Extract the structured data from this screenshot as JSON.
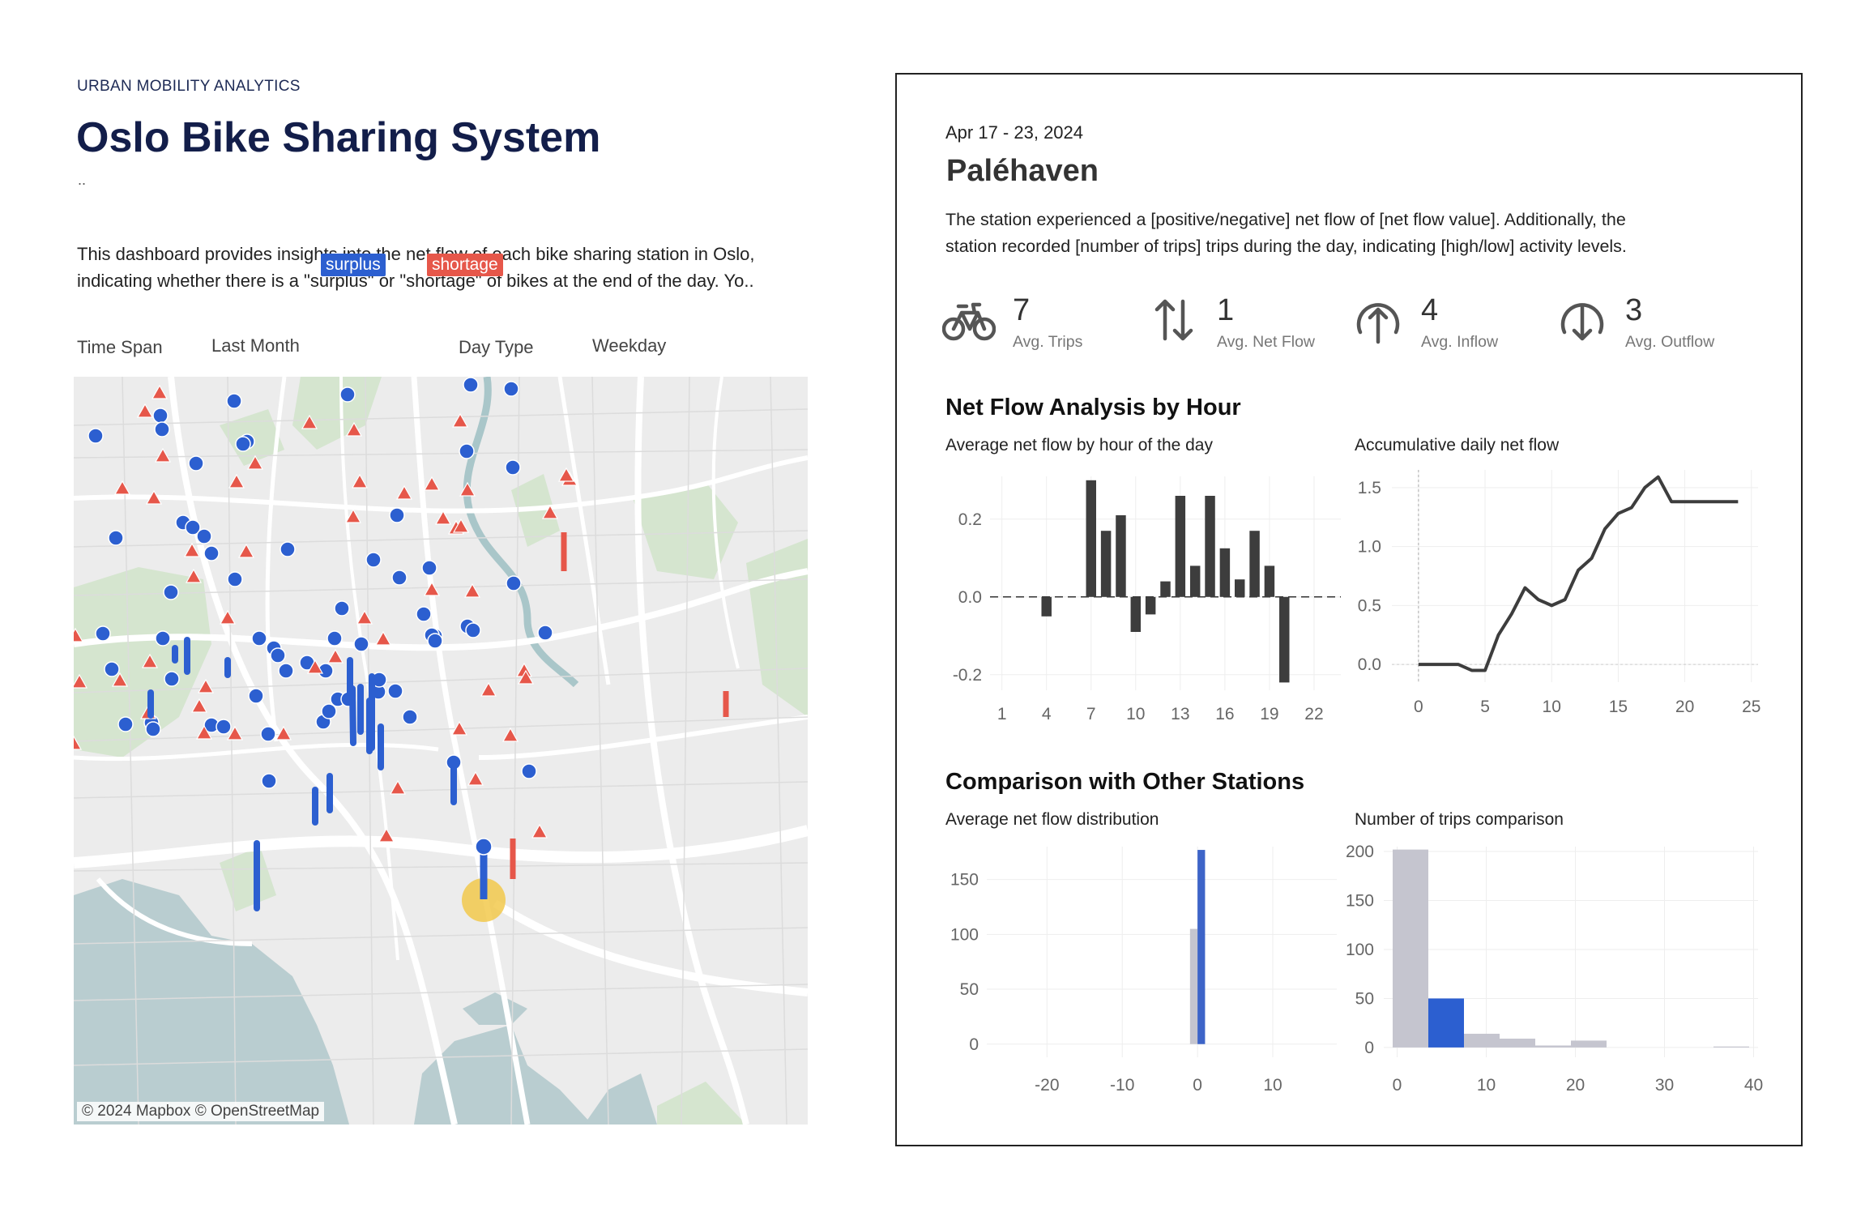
{
  "header": {
    "kicker": "URBAN MOBILITY ANALYTICS",
    "title": "Oslo Bike Sharing System",
    "subtitle": "..",
    "description_line1": "This dashboard provides insights into the net flow of each bike sharing station in Oslo,",
    "description_line2": "indicating whether there is a \"surplus\" or \"shortage\" of bikes at the end of the day. Yo..",
    "surplus_label": "surplus",
    "shortage_label": "shortage"
  },
  "filters": {
    "time_span_label": "Time Span",
    "time_span_value": "Last Month",
    "day_type_label": "Day Type",
    "day_type_value": "Weekday"
  },
  "map": {
    "attribution": "© 2024 Mapbox © OpenStreetMap",
    "surplus_color": "#2c5fd0",
    "shortage_color": "#e6574a",
    "selected_color": "#f2c94c"
  },
  "panel": {
    "date_range": "Apr 17 - 23, 2024",
    "station_name": "Paléhaven",
    "summary_line1": "The station experienced a [positive/negative] net flow of [net flow value]. Additionally, the",
    "summary_line2": "station recorded [number of trips] trips during the day, indicating [high/low] activity levels.",
    "kpis": [
      {
        "icon": "bicycle-icon",
        "value": "7",
        "label": "Avg. Trips"
      },
      {
        "icon": "up-down-arrows-icon",
        "value": "1",
        "label": "Avg. Net Flow"
      },
      {
        "icon": "inflow-arrow-icon",
        "value": "4",
        "label": "Avg. Inflow"
      },
      {
        "icon": "outflow-arrow-icon",
        "value": "3",
        "label": "Avg. Outflow"
      }
    ],
    "section1_title": "Net Flow Analysis by Hour",
    "chart1_title": "Average net flow by hour of the day",
    "chart2_title": "Accumulative daily net flow",
    "section2_title": "Comparison with Other Stations",
    "chart3_title": "Average net flow distribution",
    "chart4_title": "Number of trips comparison"
  },
  "chart_data": [
    {
      "type": "bar",
      "title": "Average net flow by hour of the day",
      "x": [
        1,
        2,
        3,
        4,
        5,
        6,
        7,
        8,
        9,
        10,
        11,
        12,
        13,
        14,
        15,
        16,
        17,
        18,
        19,
        20,
        21,
        22,
        23
      ],
      "values": [
        0,
        0,
        0,
        -0.05,
        0,
        0,
        0.3,
        0.17,
        0.21,
        -0.09,
        -0.045,
        0.04,
        0.26,
        0.08,
        0.26,
        0.125,
        0.045,
        0.17,
        0.08,
        -0.22,
        0,
        0,
        0
      ],
      "xticks": [
        1,
        4,
        7,
        10,
        13,
        16,
        19,
        22
      ],
      "yticks": [
        -0.2,
        0.0,
        0.2
      ],
      "ylim": [
        -0.24,
        0.31
      ],
      "color": "#3d3d3d"
    },
    {
      "type": "line",
      "title": "Accumulative daily net flow",
      "x": [
        0,
        1,
        2,
        3,
        4,
        5,
        6,
        7,
        8,
        9,
        10,
        11,
        12,
        13,
        14,
        15,
        16,
        17,
        18,
        19,
        20,
        21,
        22,
        23,
        24
      ],
      "values": [
        0,
        0,
        0,
        0,
        -0.05,
        -0.05,
        0.25,
        0.43,
        0.65,
        0.55,
        0.5,
        0.55,
        0.8,
        0.9,
        1.15,
        1.28,
        1.33,
        1.5,
        1.59,
        1.38,
        1.38,
        1.38,
        1.38,
        1.38,
        1.38
      ],
      "xticks": [
        0,
        5,
        10,
        15,
        20,
        25
      ],
      "yticks": [
        0.0,
        0.5,
        1.0,
        1.5
      ],
      "xlim": [
        -2,
        25.5
      ],
      "ylim": [
        -0.15,
        1.65
      ],
      "color": "#3d3d3d"
    },
    {
      "type": "bar",
      "title": "Average net flow distribution",
      "bins": [
        {
          "x0": -1,
          "x1": 0,
          "value": 105,
          "highlight": false
        },
        {
          "x0": 0,
          "x1": 1,
          "value": 177,
          "highlight": true
        }
      ],
      "xticks": [
        -20,
        -10,
        0,
        10
      ],
      "yticks": [
        0,
        50,
        100,
        150
      ],
      "xlim": [
        -28,
        18.5
      ],
      "ylim": [
        -12,
        180
      ],
      "highlight_color": "#3d64c8",
      "base_color": "#c5c5cf"
    },
    {
      "type": "bar",
      "title": "Number of trips comparison",
      "bins": [
        {
          "x0": -0.5,
          "x1": 3.5,
          "value": 202,
          "highlight": false
        },
        {
          "x0": 3.5,
          "x1": 7.5,
          "value": 50,
          "highlight": true
        },
        {
          "x0": 7.5,
          "x1": 11.5,
          "value": 14,
          "highlight": false
        },
        {
          "x0": 11.5,
          "x1": 15.5,
          "value": 9,
          "highlight": false
        },
        {
          "x0": 15.5,
          "x1": 19.5,
          "value": 2,
          "highlight": false
        },
        {
          "x0": 19.5,
          "x1": 23.5,
          "value": 7,
          "highlight": false
        },
        {
          "x0": 35.5,
          "x1": 39.5,
          "value": 1,
          "highlight": false
        }
      ],
      "xticks": [
        0,
        10,
        20,
        30,
        40
      ],
      "yticks": [
        0,
        50,
        100,
        150,
        200
      ],
      "xlim": [
        -1.5,
        40.5
      ],
      "ylim": [
        -10,
        205
      ],
      "highlight_color": "#2c5fd0",
      "base_color": "#c5c5cf"
    }
  ]
}
